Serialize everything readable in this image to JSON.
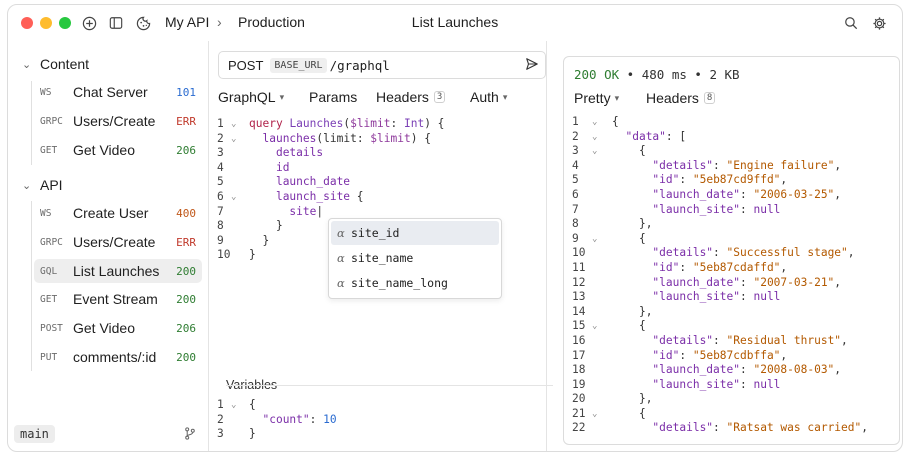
{
  "titlebar": {
    "workspace": "My API",
    "separator": "›",
    "environment": "Production",
    "title": "List Launches"
  },
  "sidebar": {
    "sections": [
      {
        "label": "Content",
        "items": [
          {
            "method": "WS",
            "name": "Chat Server",
            "code": "101"
          },
          {
            "method": "GRPC",
            "name": "Users/Create",
            "code": "ERR"
          },
          {
            "method": "GET",
            "name": "Get Video",
            "code": "206"
          }
        ]
      },
      {
        "label": "API",
        "items": [
          {
            "method": "WS",
            "name": "Create User",
            "code": "400"
          },
          {
            "method": "GRPC",
            "name": "Users/Create",
            "code": "ERR"
          },
          {
            "method": "GQL",
            "name": "List Launches",
            "code": "200"
          },
          {
            "method": "GET",
            "name": "Event Stream",
            "code": "200"
          },
          {
            "method": "POST",
            "name": "Get Video",
            "code": "206"
          },
          {
            "method": "PUT",
            "name": "comments/:id",
            "code": "200"
          }
        ]
      }
    ],
    "branch": "main"
  },
  "request": {
    "method": "POST",
    "variable": "BASE_URL",
    "path": "/graphql",
    "tabs": {
      "graphql": "GraphQL",
      "params": "Params",
      "headers": "Headers",
      "headers_count": "3",
      "auth": "Auth"
    },
    "query_lines": [
      "1",
      "2",
      "3",
      "4",
      "5",
      "6",
      "7",
      "8",
      "9",
      "10"
    ],
    "query": {
      "l1_kw": "query",
      "l1_name": "Launches",
      "l1_var": "$limit",
      "l1_type": "Int",
      "l2_field": "launches",
      "l2_arg": "limit",
      "l2_var": "$limit",
      "l3": "details",
      "l4": "id",
      "l5": "launch_date",
      "l6": "launch_site",
      "l7": "site"
    },
    "autocomplete": [
      "site_id",
      "site_name",
      "site_name_long"
    ],
    "variables_label": "Variables",
    "variables": {
      "key": "\"count\"",
      "value": "10"
    }
  },
  "response": {
    "status": "200 OK",
    "time": "480 ms",
    "size": "2 KB",
    "tabs": {
      "pretty": "Pretty",
      "headers": "Headers",
      "headers_count": "8"
    },
    "data_key": "\"data\"",
    "records": [
      {
        "details": "\"Engine failure\"",
        "id": "\"5eb87cd9ffd\"",
        "launch_date": "\"2006-03-25\"",
        "launch_site": "null"
      },
      {
        "details": "\"Successful stage\"",
        "id": "\"5eb87cdaffd\"",
        "launch_date": "\"2007-03-21\"",
        "launch_site": "null"
      },
      {
        "details": "\"Residual thrust\"",
        "id": "\"5eb87cdbffa\"",
        "launch_date": "\"2008-08-03\"",
        "launch_site": "null"
      },
      {
        "details": "\"Ratsat was carried\""
      }
    ],
    "keys": {
      "details": "\"details\"",
      "id": "\"id\"",
      "launch_date": "\"launch_date\"",
      "launch_site": "\"launch_site\""
    }
  },
  "colors": {
    "ok": "#2f7d32",
    "error": "#c0392b",
    "warn": "#c0581a",
    "info": "#2a6bd0"
  }
}
